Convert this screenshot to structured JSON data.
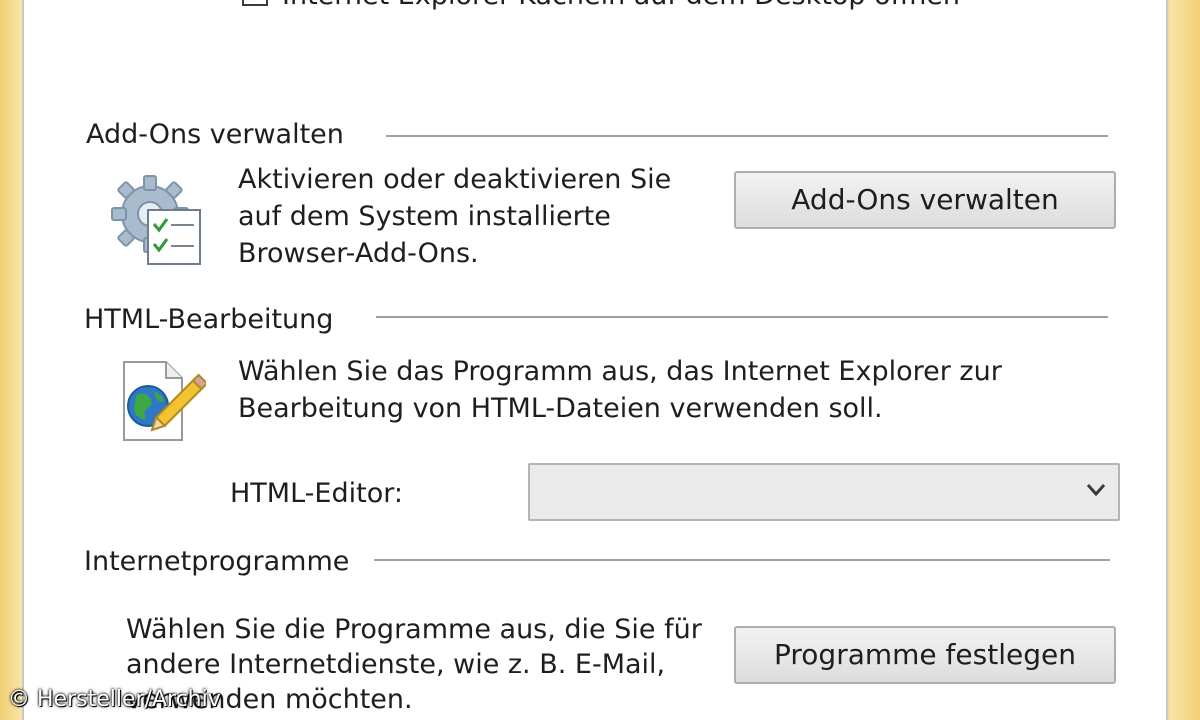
{
  "top_checkbox": {
    "label": "Internet Explorer-Kacheln auf dem Desktop öffnen",
    "checked": true
  },
  "addons": {
    "heading": "Add-Ons verwalten",
    "description": [
      "Aktivieren oder deaktivieren Sie",
      "auf dem System installierte",
      "Browser-Add-Ons."
    ],
    "button_label": "Add-Ons verwalten",
    "icon": "gear-checklist-icon"
  },
  "html_editing": {
    "heading": "HTML-Bearbeitung",
    "description": [
      "Wählen Sie das Programm aus, das Internet Explorer zur",
      "Bearbeitung von HTML-Dateien verwenden soll."
    ],
    "editor_label": "HTML-Editor:",
    "editor_value": "",
    "icon": "html-document-edit-icon"
  },
  "internet_programs": {
    "heading": "Internetprogramme",
    "description": [
      "Wählen Sie die Programme aus, die Sie für",
      "andere Internetdienste, wie z. B. E-Mail,",
      "verwenden möchten."
    ],
    "button_label": "Programme festlegen"
  },
  "watermark": "© Hersteller/Archiv",
  "colors": {
    "window_frame": "#f6dd95",
    "panel_background": "#ffffff",
    "button_face": "#e5e5e5",
    "combo_background": "#ebebeb"
  }
}
